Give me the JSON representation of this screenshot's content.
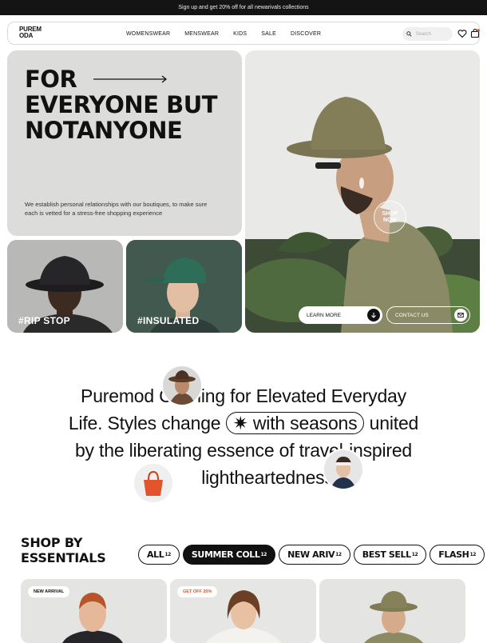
{
  "announcement": "Sign up and get 20% off for all newarivals collections",
  "brand": {
    "line1": "PUREM",
    "line2": "ODA"
  },
  "nav": {
    "items": [
      "WOMENSWEAR",
      "MENSWEAR",
      "KIDS",
      "SALE",
      "DISCOVER"
    ],
    "search_placeholder": "Search",
    "icons": [
      "search-icon",
      "heart-icon",
      "bag-icon"
    ]
  },
  "hero": {
    "title_line1": "FOR",
    "title_line2": "EVERYONE BUT",
    "title_line3": "NOTANYONE",
    "description": "We establish personal relationships with our boutiques, to make sure each is vetted for a stress-free shopping experience",
    "tile1_tag": "#RIP STOP",
    "tile2_tag": "#INSULATED",
    "shop_now_line1": "SHOP",
    "shop_now_line2": "NOW",
    "learn_more": "LEARN MORE",
    "contact_us": "CONTACT US"
  },
  "statement": {
    "part1": "Puremod Clothing for Elevated Everyday",
    "part2": "Life. Styles change",
    "pill": "with seasons",
    "part3": "united",
    "part4": "by the liberating essence of travel-inspired",
    "part5": "lightheartedness"
  },
  "shop": {
    "title_line1": "SHOP BY",
    "title_line2": "ESSENTIALS",
    "filters": [
      {
        "label": "ALL",
        "count": "12"
      },
      {
        "label": "SUMMER COLL",
        "count": "12"
      },
      {
        "label": "NEW ARIV",
        "count": "12"
      },
      {
        "label": "BEST SELL",
        "count": "12"
      },
      {
        "label": "FLASH",
        "count": "12"
      }
    ],
    "active_filter": "SUMMER COLL",
    "cards": [
      {
        "badge": "NEW ARRIVAL"
      },
      {
        "badge": "GET OFF 20%"
      },
      {
        "badge": ""
      }
    ]
  },
  "colors": {
    "dark": "#141414",
    "hero_bg": "#dcdcda",
    "tile_green": "#3f5a4f",
    "badge_orange": "#d4572a",
    "olive": "#8a8a5e"
  }
}
